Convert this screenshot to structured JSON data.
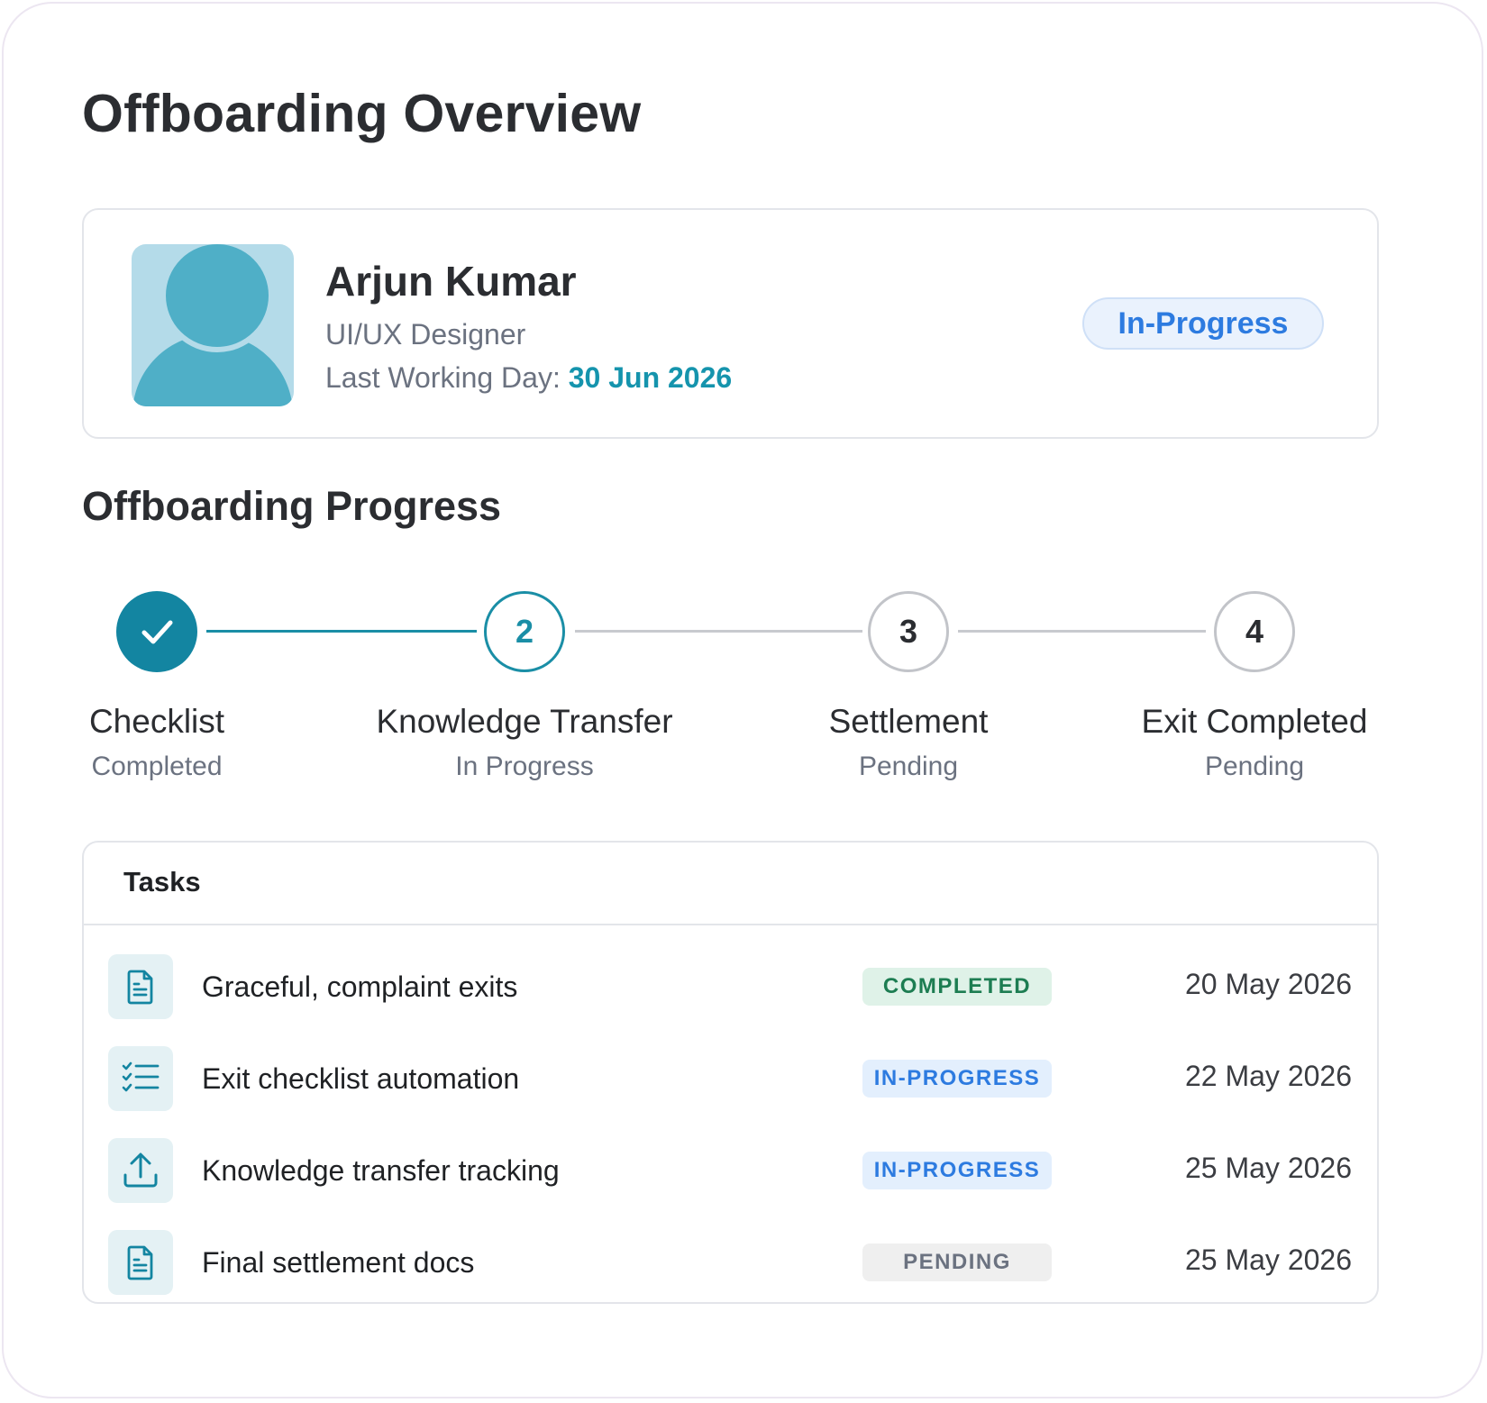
{
  "page": {
    "title": "Offboarding Overview"
  },
  "profile": {
    "name": "Arjun Kumar",
    "role": "UI/UX Designer",
    "lwd_label": "Last Working Day: ",
    "lwd_date": "30 Jun 2026",
    "status": "In-Progress"
  },
  "progress": {
    "title": "Offboarding Progress",
    "steps": [
      {
        "number": "",
        "label": "Checklist",
        "status": "Completed",
        "icon": "check-icon"
      },
      {
        "number": "2",
        "label": "Knowledge Transfer",
        "status": "In Progress"
      },
      {
        "number": "3",
        "label": "Settlement",
        "status": "Pending"
      },
      {
        "number": "4",
        "label": "Exit Completed",
        "status": "Pending"
      }
    ]
  },
  "tasks": {
    "title": "Tasks",
    "rows": [
      {
        "name": "Graceful, complaint exits",
        "status": "COMPLETED",
        "date": "20 May 2026",
        "icon": "document-icon"
      },
      {
        "name": "Exit checklist automation",
        "status": "IN-PROGRESS",
        "date": "22 May 2026",
        "icon": "checklist-icon"
      },
      {
        "name": "Knowledge transfer tracking",
        "status": "IN-PROGRESS",
        "date": "25 May 2026",
        "icon": "upload-icon"
      },
      {
        "name": "Final settlement docs",
        "status": "PENDING",
        "date": "25 May 2026",
        "icon": "document-icon"
      }
    ]
  },
  "colors": {
    "accent": "#1594ad",
    "in_progress": "#2d7be0",
    "completed": "#1d7d52",
    "pending": "#6b7280"
  }
}
